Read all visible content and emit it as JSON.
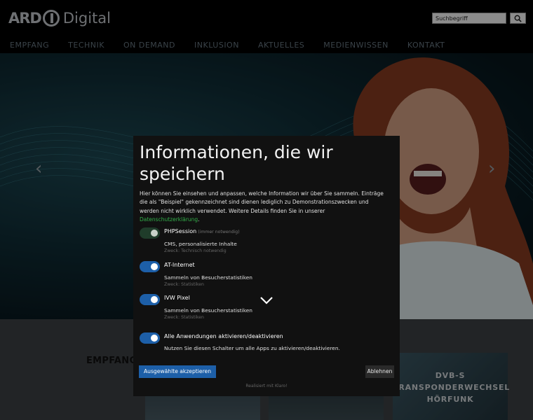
{
  "header": {
    "logo_ard": "ARD",
    "logo_digital": "Digital",
    "search_placeholder": "Suchbegriff"
  },
  "nav": {
    "items": [
      "EMPFANG",
      "TECHNIK",
      "ON DEMAND",
      "INKLUSION",
      "AKTUELLES",
      "MEDIENWISSEN",
      "KONTAKT"
    ]
  },
  "hero": {
    "prev_arrow": "‹",
    "next_arrow": "›"
  },
  "content": {
    "section_title": "EMPFANG",
    "tile_text": [
      "DVB-S",
      "TRANSPONDERWECHSEL",
      "HÖRFUNK"
    ]
  },
  "consent": {
    "title": "Informationen, die wir speichern",
    "intro_text": "Hier können Sie einsehen und anpassen, welche Information wir über Sie sammeln. Einträge die als \"Beispiel\" gekennzeichnet sind dienen lediglich zu Demonstrationszwecken und werden nicht wirklich verwendet.  Weitere Details finden Sie in unserer ",
    "intro_link": "Datenschutzerklärung",
    "intro_end": ".",
    "options": [
      {
        "name": "PHPSession",
        "required": "(immer notwendig)",
        "desc": "CMS, personalisierte Inhalte",
        "purpose": "Zweck: Technisch notwendig",
        "state": "required"
      },
      {
        "name": "AT-Internet",
        "required": "",
        "desc": "Sammeln von Besucherstatistiken",
        "purpose": "Zweck: Statistiken",
        "state": "on"
      },
      {
        "name": "IVW Pixel",
        "required": "",
        "desc": "Sammeln von Besucherstatistiken",
        "purpose": "Zweck: Statistiken",
        "state": "on"
      },
      {
        "name": "Alle Anwendungen aktivieren/deaktivieren",
        "required": "",
        "desc": "Nutzen Sie diesen Schalter um alle Apps zu aktivieren/deaktivieren.",
        "purpose": "",
        "state": "on"
      }
    ],
    "accept_label": "Ausgewählte akzeptieren",
    "decline_label": "Ablehnen",
    "powered_by": "Realisiert mit Klaro!"
  },
  "colors": {
    "accent_blue": "#1d5fa8",
    "link_green": "#33b04a",
    "modal_bg": "#111111"
  }
}
